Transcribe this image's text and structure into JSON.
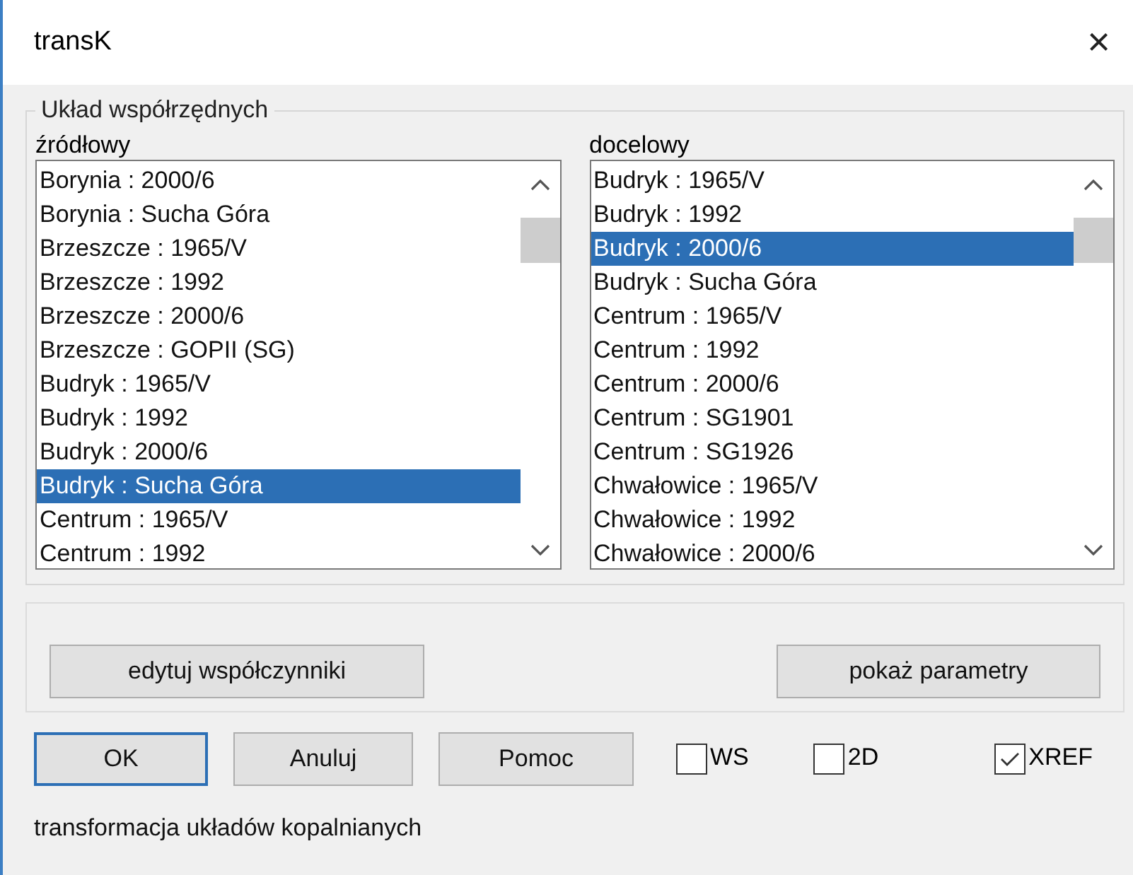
{
  "window": {
    "title": "transK",
    "close": "×"
  },
  "group": {
    "title": "Układ współrzędnych",
    "lists": [
      {
        "label": "źródłowy",
        "items": [
          {
            "text": "Borynia : 2000/6",
            "selected": false
          },
          {
            "text": "Borynia : Sucha Góra",
            "selected": false
          },
          {
            "text": "Brzeszcze : 1965/V",
            "selected": false
          },
          {
            "text": "Brzeszcze : 1992",
            "selected": false
          },
          {
            "text": "Brzeszcze : 2000/6",
            "selected": false
          },
          {
            "text": "Brzeszcze : GOPII (SG)",
            "selected": false
          },
          {
            "text": "Budryk : 1965/V",
            "selected": false
          },
          {
            "text": "Budryk : 1992",
            "selected": false
          },
          {
            "text": "Budryk : 2000/6",
            "selected": false
          },
          {
            "text": "Budryk : Sucha Góra",
            "selected": true
          },
          {
            "text": "Centrum : 1965/V",
            "selected": false
          },
          {
            "text": "Centrum : 1992",
            "selected": false
          }
        ]
      },
      {
        "label": "docelowy",
        "items": [
          {
            "text": "Budryk : 1965/V",
            "selected": false
          },
          {
            "text": "Budryk : 1992",
            "selected": false
          },
          {
            "text": "Budryk : 2000/6",
            "selected": true
          },
          {
            "text": "Budryk : Sucha Góra",
            "selected": false
          },
          {
            "text": "Centrum : 1965/V",
            "selected": false
          },
          {
            "text": "Centrum : 1992",
            "selected": false
          },
          {
            "text": "Centrum : 2000/6",
            "selected": false
          },
          {
            "text": "Centrum : SG1901",
            "selected": false
          },
          {
            "text": "Centrum : SG1926",
            "selected": false
          },
          {
            "text": "Chwałowice : 1965/V",
            "selected": false
          },
          {
            "text": "Chwałowice : 1992",
            "selected": false
          },
          {
            "text": "Chwałowice : 2000/6",
            "selected": false
          }
        ]
      }
    ]
  },
  "panel_buttons": [
    "edytuj współczynniki",
    "pokaż parametry"
  ],
  "buttons": [
    {
      "label": "OK",
      "default": true
    },
    {
      "label": "Anuluj",
      "default": false
    },
    {
      "label": "Pomoc",
      "default": false
    }
  ],
  "checkboxes": [
    {
      "label": "WS",
      "checked": false
    },
    {
      "label": "2D",
      "checked": false
    },
    {
      "label": "XREF",
      "checked": true
    }
  ],
  "status": "transformacja układów kopalnianych"
}
